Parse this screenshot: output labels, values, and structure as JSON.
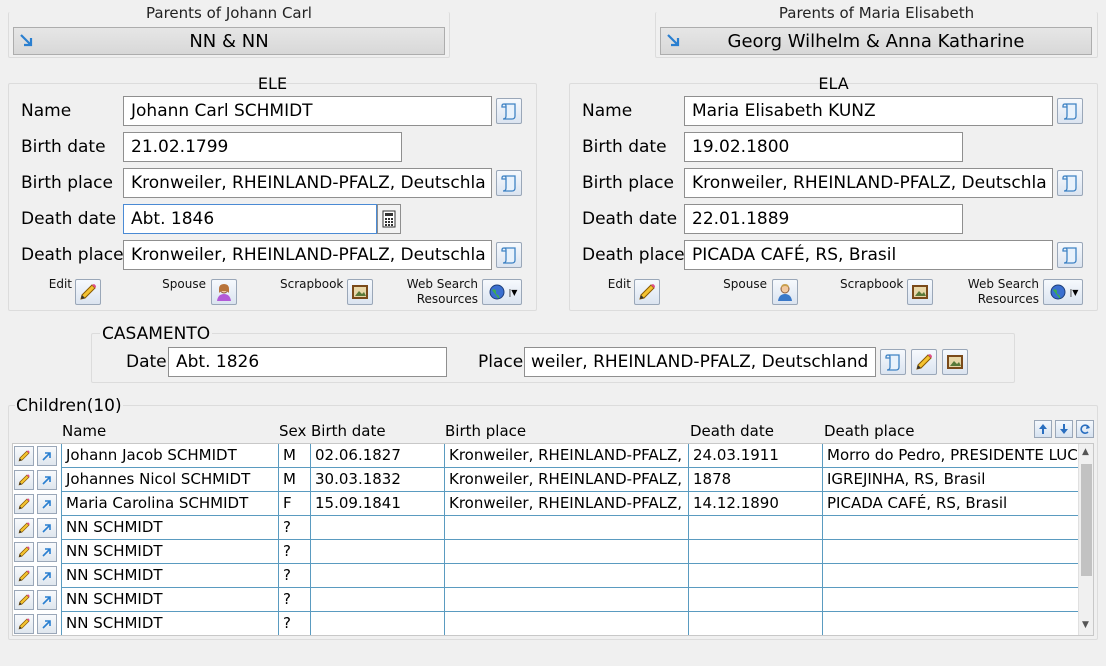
{
  "parents_left": {
    "title": "Parents of Johann Carl",
    "button": "NN & NN"
  },
  "parents_right": {
    "title": "Parents of Maria Elisabeth",
    "button": "Georg Wilhelm & Anna Katharine"
  },
  "ele": {
    "title": "ELE",
    "name_label": "Name",
    "name": "Johann Carl SCHMIDT",
    "birth_date_label": "Birth date",
    "birth_date": "21.02.1799",
    "birth_place_label": "Birth place",
    "birth_place": "Kronweiler, RHEINLAND-PFALZ, Deutschla",
    "death_date_label": "Death date",
    "death_date": "Abt. 1846",
    "death_place_label": "Death place",
    "death_place": "Kronweiler, RHEINLAND-PFALZ, Deutschla",
    "edit_label": "Edit",
    "spouse_label": "Spouse",
    "scrapbook_label": "Scrapbook",
    "web_label_1": "Web Search",
    "web_label_2": "Resources"
  },
  "ela": {
    "title": "ELA",
    "name_label": "Name",
    "name": "Maria Elisabeth KUNZ",
    "birth_date_label": "Birth date",
    "birth_date": "19.02.1800",
    "birth_place_label": "Birth place",
    "birth_place": "Kronweiler, RHEINLAND-PFALZ, Deutschla",
    "death_date_label": "Death date",
    "death_date": "22.01.1889",
    "death_place_label": "Death place",
    "death_place": "PICADA CAFÉ, RS, Brasil",
    "edit_label": "Edit",
    "spouse_label": "Spouse",
    "scrapbook_label": "Scrapbook",
    "web_label_1": "Web Search",
    "web_label_2": "Resources"
  },
  "marriage": {
    "title": "CASAMENTO",
    "date_label": "Date",
    "date": "Abt. 1826",
    "place_label": "Place",
    "place": "weiler, RHEINLAND-PFALZ, Deutschland"
  },
  "children": {
    "title": "Children(10)",
    "headers": {
      "name": "Name",
      "sex": "Sex",
      "birth_date": "Birth date",
      "birth_place": "Birth place",
      "death_date": "Death date",
      "death_place": "Death place"
    },
    "rows": [
      {
        "name": "Johann Jacob SCHMIDT",
        "sex": "M",
        "birth_date": "02.06.1827",
        "birth_place": "Kronweiler, RHEINLAND-PFALZ, I",
        "death_date": "24.03.1911",
        "death_place": "Morro do Pedro, PRESIDENTE LUC"
      },
      {
        "name": "Johannes Nicol SCHMIDT",
        "sex": "M",
        "birth_date": "30.03.1832",
        "birth_place": "Kronweiler, RHEINLAND-PFALZ, I",
        "death_date": "1878",
        "death_place": "IGREJINHA, RS, Brasil"
      },
      {
        "name": "Maria Carolina SCHMIDT",
        "sex": "F",
        "birth_date": "15.09.1841",
        "birth_place": "Kronweiler, RHEINLAND-PFALZ, I",
        "death_date": "14.12.1890",
        "death_place": "PICADA CAFÉ, RS, Brasil"
      },
      {
        "name": "NN SCHMIDT",
        "sex": "?",
        "birth_date": "",
        "birth_place": "",
        "death_date": "",
        "death_place": ""
      },
      {
        "name": "NN SCHMIDT",
        "sex": "?",
        "birth_date": "",
        "birth_place": "",
        "death_date": "",
        "death_place": ""
      },
      {
        "name": "NN SCHMIDT",
        "sex": "?",
        "birth_date": "",
        "birth_place": "",
        "death_date": "",
        "death_place": ""
      },
      {
        "name": "NN SCHMIDT",
        "sex": "?",
        "birth_date": "",
        "birth_place": "",
        "death_date": "",
        "death_place": ""
      },
      {
        "name": "NN SCHMIDT",
        "sex": "?",
        "birth_date": "",
        "birth_place": "",
        "death_date": "",
        "death_place": ""
      }
    ]
  },
  "icons": {
    "parent_link": "arrow-down-right-icon",
    "source": "scroll-icon",
    "calc": "calculator-icon",
    "edit": "pencil-icon",
    "spouse_female": "female-person-icon",
    "spouse_male": "male-person-icon",
    "scrapbook": "picture-frame-icon",
    "web": "globe-icon",
    "sort_up": "arrow-up-icon",
    "sort_down": "arrow-down-icon",
    "refresh": "refresh-icon"
  }
}
